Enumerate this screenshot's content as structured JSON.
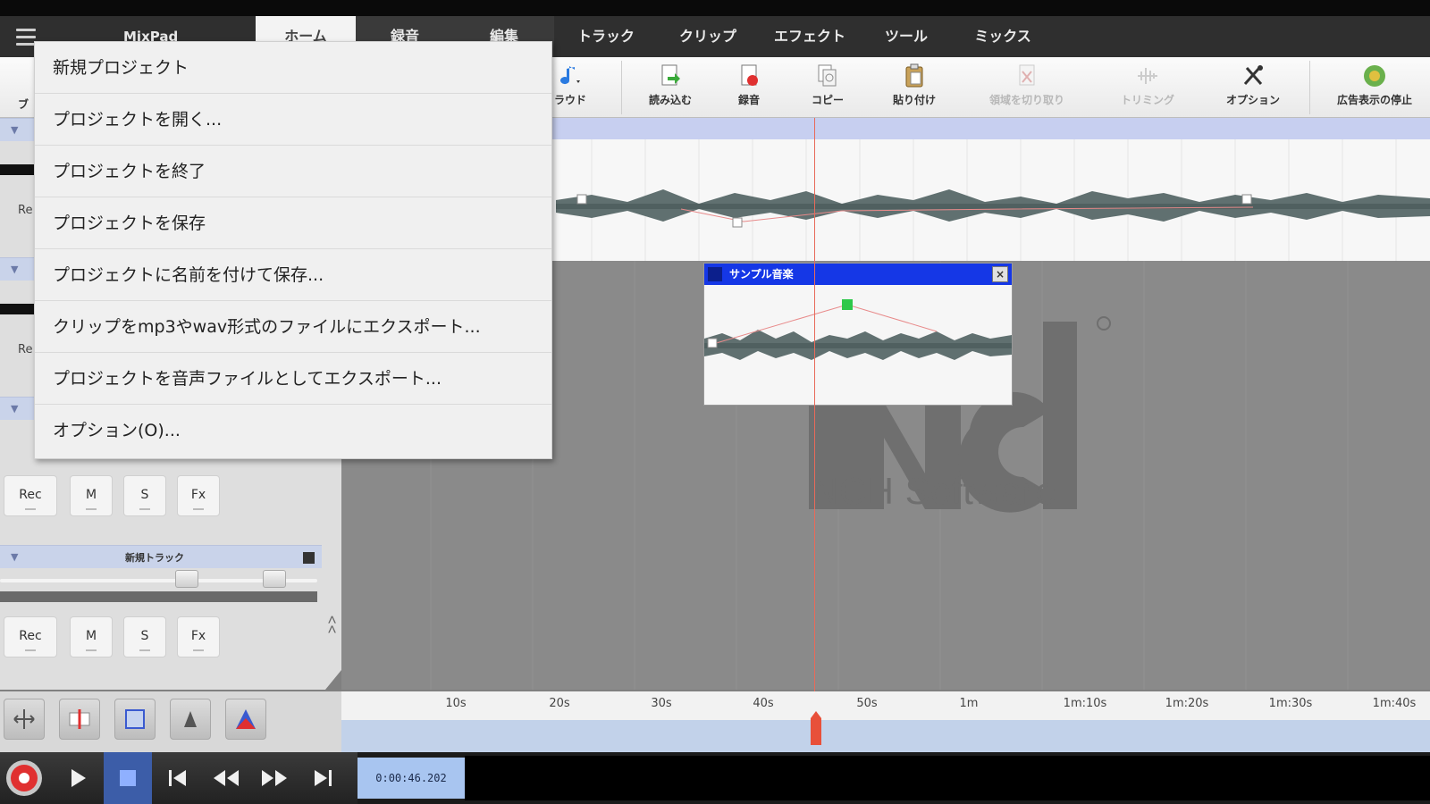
{
  "app": {
    "title": "MixPad"
  },
  "tabs": [
    {
      "label": "ホーム",
      "active": true
    },
    {
      "label": "録音"
    },
    {
      "label": "編集"
    },
    {
      "label": "トラック"
    },
    {
      "label": "クリップ"
    },
    {
      "label": "エフェクト"
    },
    {
      "label": "ツール"
    },
    {
      "label": "ミックス"
    }
  ],
  "toolbar": {
    "partial_left": "ブ",
    "partial_sound": "ラウド",
    "items": [
      {
        "label": "読み込む",
        "icon": "import-icon",
        "enabled": true
      },
      {
        "label": "録音",
        "icon": "record-clip-icon",
        "enabled": true
      },
      {
        "label": "コピー",
        "icon": "copy-icon",
        "enabled": true
      },
      {
        "label": "貼り付け",
        "icon": "paste-icon",
        "enabled": true
      },
      {
        "label": "領域を切り取り",
        "icon": "cut-region-icon",
        "enabled": false
      },
      {
        "label": "トリミング",
        "icon": "trim-icon",
        "enabled": false
      },
      {
        "label": "オプション",
        "icon": "options-icon",
        "enabled": true
      },
      {
        "label": "広告表示の停止",
        "icon": "stop-ads-icon",
        "enabled": true
      }
    ]
  },
  "menu": {
    "items": [
      "新規プロジェクト",
      "プロジェクトを開く...",
      "プロジェクトを終了",
      "プロジェクトを保存",
      "プロジェクトに名前を付けて保存...",
      "クリップをmp3やwav形式のファイルにエクスポート...",
      "プロジェクトを音声ファイルとしてエクスポート...",
      "オプション(O)..."
    ]
  },
  "track_panel": {
    "buttons": {
      "rec": "Rec",
      "mute": "M",
      "solo": "S",
      "fx": "Fx"
    },
    "new_track_name": "新規トラック",
    "partial_rec": "Re",
    "collapse": "<<"
  },
  "clip": {
    "title": "サンプル音楽"
  },
  "watermark": {
    "text": "NCH Software"
  },
  "ruler": {
    "ticks": [
      "10s",
      "20s",
      "30s",
      "40s",
      "50s",
      "1m",
      "1m:10s",
      "1m:20s",
      "1m:30s",
      "1m:40s"
    ]
  },
  "transport": {
    "time": "0:00:46.202"
  },
  "colors": {
    "accent_blue": "#1537e6",
    "playhead": "#e86a5a",
    "record": "#e03030"
  }
}
